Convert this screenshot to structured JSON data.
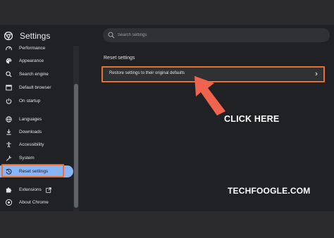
{
  "header": {
    "title": "Settings",
    "logo_icon": "chrome-icon",
    "search": {
      "placeholder": "Search settings",
      "icon": "search-icon"
    }
  },
  "sidebar": {
    "items": [
      {
        "label": "Performance",
        "icon": "speedometer-icon"
      },
      {
        "label": "Appearance",
        "icon": "palette-icon"
      },
      {
        "label": "Search engine",
        "icon": "search-icon"
      },
      {
        "label": "Default browser",
        "icon": "browser-window-icon"
      },
      {
        "label": "On startup",
        "icon": "power-icon"
      },
      {
        "label": "Languages",
        "icon": "globe-icon"
      },
      {
        "label": "Downloads",
        "icon": "download-icon"
      },
      {
        "label": "Accessibility",
        "icon": "accessibility-icon"
      },
      {
        "label": "System",
        "icon": "wrench-icon"
      },
      {
        "label": "Reset settings",
        "icon": "reset-history-icon",
        "active": true
      },
      {
        "label": "Extensions",
        "icon": "puzzle-icon",
        "trailing_icon": "external-link-icon"
      },
      {
        "label": "About Chrome",
        "icon": "chrome-icon"
      }
    ]
  },
  "main": {
    "section_title": "Reset settings",
    "rows": [
      {
        "label": "Restore settings to their original defaults",
        "icon": "chevron-right-icon"
      }
    ]
  },
  "annotations": {
    "callout": "CLICK HERE",
    "watermark": "TECHFOOGLE.COM",
    "highlight_color": "#e8712d",
    "arrow_color": "#f0634f"
  },
  "colors": {
    "background": "#202124",
    "surface": "#303134",
    "accent": "#8ab4f8",
    "text": "#e3e3e3"
  }
}
